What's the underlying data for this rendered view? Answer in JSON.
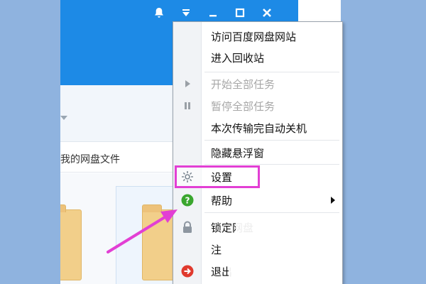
{
  "window": {
    "controls": [
      "bell-icon",
      "dropdown-icon",
      "minimize-icon",
      "maximize-icon",
      "close-icon"
    ],
    "path_text": "我的网盘文件"
  },
  "menu": {
    "items": [
      {
        "label": "访问百度网盘网站",
        "enabled": true
      },
      {
        "label": "进入回收站",
        "enabled": true
      },
      {
        "label": "开始全部任务",
        "enabled": false,
        "icon": "play-icon"
      },
      {
        "label": "暂停全部任务",
        "enabled": false,
        "icon": "pause-icon"
      },
      {
        "label": "本次传输完自动关机",
        "enabled": true
      },
      {
        "label": "隐藏悬浮窗",
        "enabled": true
      },
      {
        "label": "设置",
        "enabled": true,
        "icon": "gear-icon",
        "highlighted": true
      },
      {
        "label": "帮助",
        "enabled": true,
        "icon": "help-icon",
        "has_submenu": true
      },
      {
        "label": "锁定网盘",
        "enabled": true,
        "icon": "lock-icon"
      },
      {
        "label": "注",
        "enabled": true
      },
      {
        "label": "退出",
        "enabled": true,
        "icon": "exit-icon"
      }
    ]
  },
  "colors": {
    "titlebar": "#1d8ae6",
    "highlight": "#e23fd4",
    "help_icon": "#3aa62e",
    "exit_icon": "#e03a2e"
  }
}
